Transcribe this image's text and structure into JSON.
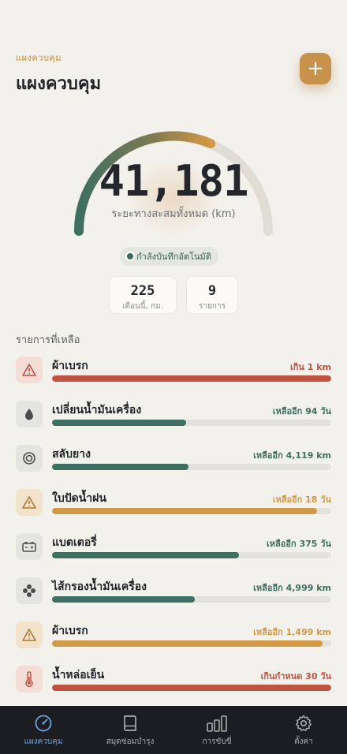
{
  "header": {
    "eyebrow": "แผงควบคุม",
    "title": "แผงควบคุม",
    "add_label": "+"
  },
  "gauge": {
    "value": "41,181",
    "caption": "ระยะทางสะสมทั้งหมด (km)"
  },
  "auto_status": "กำลังบันทึกอัตโนมัติ",
  "stats": [
    {
      "value": "225",
      "label": "เดือนนี้, กม."
    },
    {
      "value": "9",
      "label": "รายการ"
    }
  ],
  "section_title": "รายการที่เหลือ",
  "colors": {
    "red": "#c0533f",
    "green": "#3f6e62",
    "orange": "#d39845",
    "accent": "#c9924a",
    "blue": "#6aa0e8"
  },
  "items": [
    {
      "name": "ผ้าเบรก",
      "status": "เกิน 1 km",
      "tone": "red",
      "fill": 1.0,
      "icon": "warning-icon"
    },
    {
      "name": "เปลี่ยนน้ำมันเครื่อง",
      "status": "เหลืออีก 94 วัน",
      "tone": "green",
      "fill": 0.48,
      "icon": "oil-drop-icon"
    },
    {
      "name": "สลับยาง",
      "status": "เหลืออีก 4,119 km",
      "tone": "green",
      "fill": 0.49,
      "icon": "tire-icon"
    },
    {
      "name": "ใบปัดน้ำฝน",
      "status": "เหลืออีก 18 วัน",
      "tone": "orange",
      "fill": 0.95,
      "icon": "warning-icon"
    },
    {
      "name": "แบตเตอรี่",
      "status": "เหลืออีก 375 วัน",
      "tone": "green",
      "fill": 0.67,
      "icon": "battery-icon"
    },
    {
      "name": "ไส้กรองน้ำมันเครื่อง",
      "status": "เหลืออีก 4,999 km",
      "tone": "green",
      "fill": 0.51,
      "icon": "filter-icon"
    },
    {
      "name": "ผ้าเบรก",
      "status": "เหลืออีก 1,499 km",
      "tone": "orange",
      "fill": 0.97,
      "icon": "warning-icon"
    },
    {
      "name": "น้ำหล่อเย็น",
      "status": "เกินกำหนด 30 วัน",
      "tone": "red",
      "fill": 1.0,
      "icon": "thermometer-icon"
    }
  ],
  "tabs": [
    {
      "label": "แผงควบคุม",
      "icon": "gauge-icon",
      "active": true
    },
    {
      "label": "สมุดซ่อมบำรุง",
      "icon": "book-icon",
      "active": false
    },
    {
      "label": "การขับขี่",
      "icon": "bars-icon",
      "active": false
    },
    {
      "label": "ตั้งค่า",
      "icon": "gear-icon",
      "active": false
    }
  ]
}
